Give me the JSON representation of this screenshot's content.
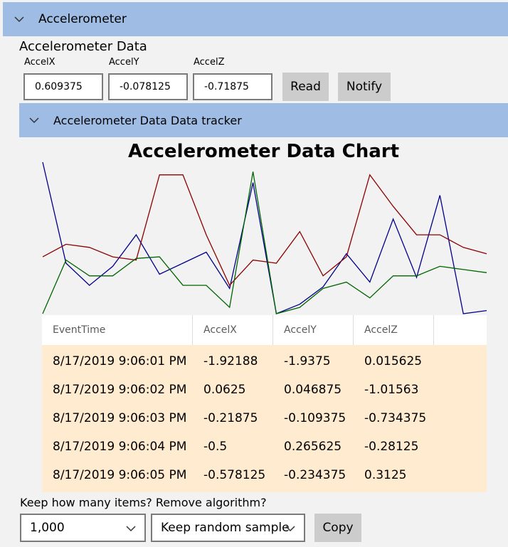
{
  "expander": {
    "title": "Accelerometer"
  },
  "section": {
    "title": "Accelerometer Data"
  },
  "fields": [
    {
      "label": "AccelX",
      "value": "0.609375"
    },
    {
      "label": "AccelY",
      "value": "-0.078125"
    },
    {
      "label": "AccelZ",
      "value": "-0.71875"
    }
  ],
  "buttons": {
    "read": "Read",
    "notify": "Notify",
    "copy": "Copy"
  },
  "tracker": {
    "title": "Accelerometer Data Data tracker"
  },
  "chart_data": {
    "type": "line",
    "title": "Accelerometer Data Chart",
    "series": [
      {
        "values": [
          -0.2,
          -3.4,
          -4.1,
          -3.5,
          -2.5,
          -3.75,
          -3.4,
          -3.05,
          -4.2,
          -0.85,
          -5.0,
          -4.7,
          -4.15,
          -3.1,
          -4.0,
          -2.0,
          -3.85,
          -1.25,
          -5.0,
          -4.9
        ],
        "color": "#00008b"
      },
      {
        "values": [
          -3.2,
          -2.8,
          -2.9,
          -3.2,
          -3.3,
          -0.6,
          -0.6,
          -2.5,
          -4.1,
          -3.3,
          -3.4,
          -2.4,
          -3.8,
          -3.2,
          -0.6,
          -1.6,
          -2.5,
          -2.5,
          -2.9,
          -3.1
        ],
        "color": "#8b0000"
      },
      {
        "values": [
          -5.0,
          -3.3,
          -3.8,
          -3.8,
          -3.25,
          -3.2,
          -4.1,
          -4.1,
          -4.8,
          -0.5,
          -5.0,
          -4.8,
          -4.2,
          -4.0,
          -4.5,
          -3.8,
          -3.8,
          -3.5,
          -3.6,
          -3.7
        ],
        "color": "#006400"
      }
    ],
    "grid": false,
    "legend": "none"
  },
  "table": {
    "columns": [
      "EventTime",
      "AccelX",
      "AccelY",
      "AccelZ"
    ],
    "rows": [
      [
        "8/17/2019 9:06:01 PM",
        "-1.92188",
        "-1.9375",
        "0.015625"
      ],
      [
        "8/17/2019 9:06:02 PM",
        "0.0625",
        "0.046875",
        "-1.01563"
      ],
      [
        "8/17/2019 9:06:03 PM",
        "-0.21875",
        "-0.109375",
        "-0.734375"
      ],
      [
        "8/17/2019 9:06:04 PM",
        "-0.5",
        "0.265625",
        "-0.28125"
      ],
      [
        "8/17/2019 9:06:05 PM",
        "-0.578125",
        "-0.234375",
        "0.3125"
      ]
    ]
  },
  "keep": {
    "label": "Keep how many items? Remove algorithm?",
    "count_value": "1,000",
    "algorithm_value": "Keep random sample"
  }
}
